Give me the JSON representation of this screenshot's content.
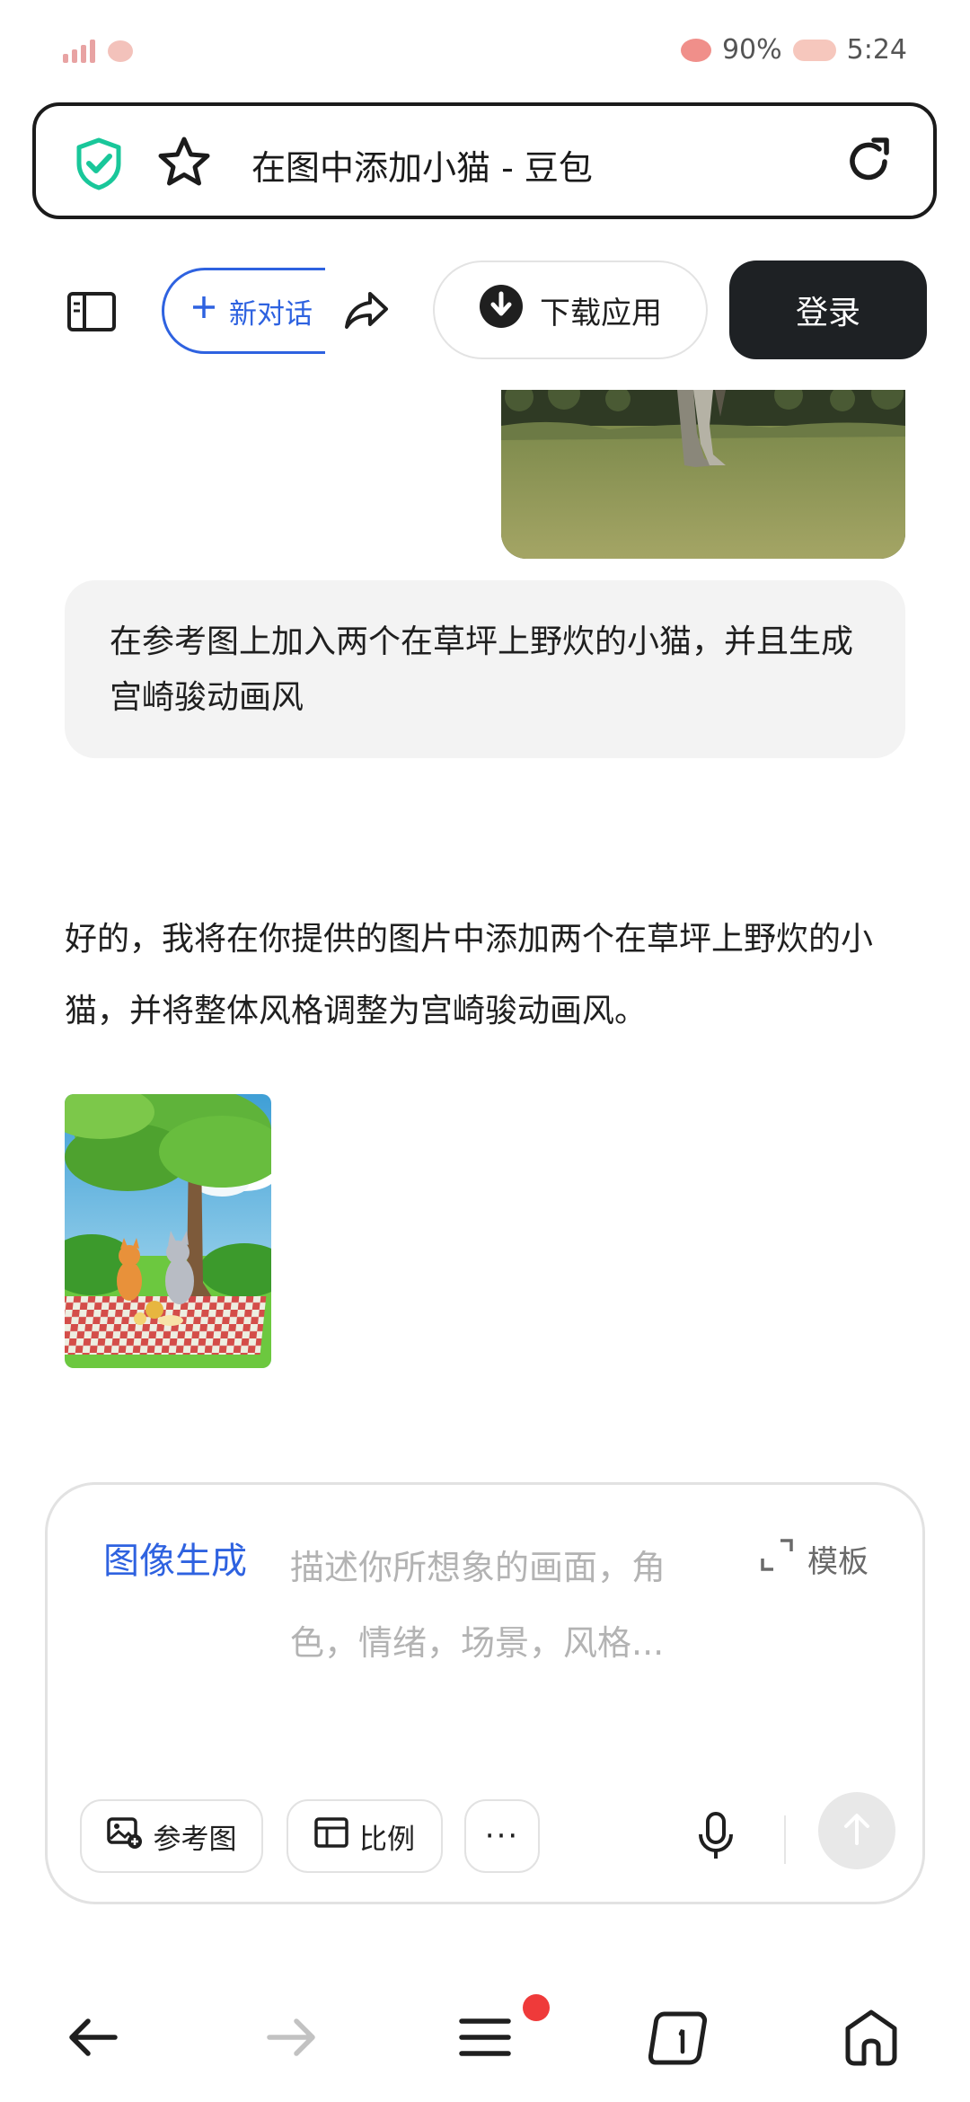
{
  "status_bar": {
    "battery": "90%",
    "time": "5:24"
  },
  "url_bar": {
    "title": "在图中添加小猫 - 豆包"
  },
  "toolbar": {
    "new_chat_label": "新对话",
    "download_label": "下载应用",
    "login_label": "登录"
  },
  "chat": {
    "user_message": "在参考图上加入两个在草坪上野炊的小猫，并且生成宫崎骏动画风",
    "ai_reply": "好的，我将在你提供的图片中添加两个在草坪上野炊的小猫，并将整体风格调整为宫崎骏动画风。"
  },
  "composer": {
    "mode_label": "图像生成",
    "placeholder": "描述你所想象的画面，角色，情绪，场景，风格...",
    "template_label": "模板",
    "ref_image_label": "参考图",
    "ratio_label": "比例",
    "more_label": "···"
  },
  "colors": {
    "accent": "#2e62e0",
    "login_bg": "#1e2124",
    "badge": "#ef3a3a"
  }
}
